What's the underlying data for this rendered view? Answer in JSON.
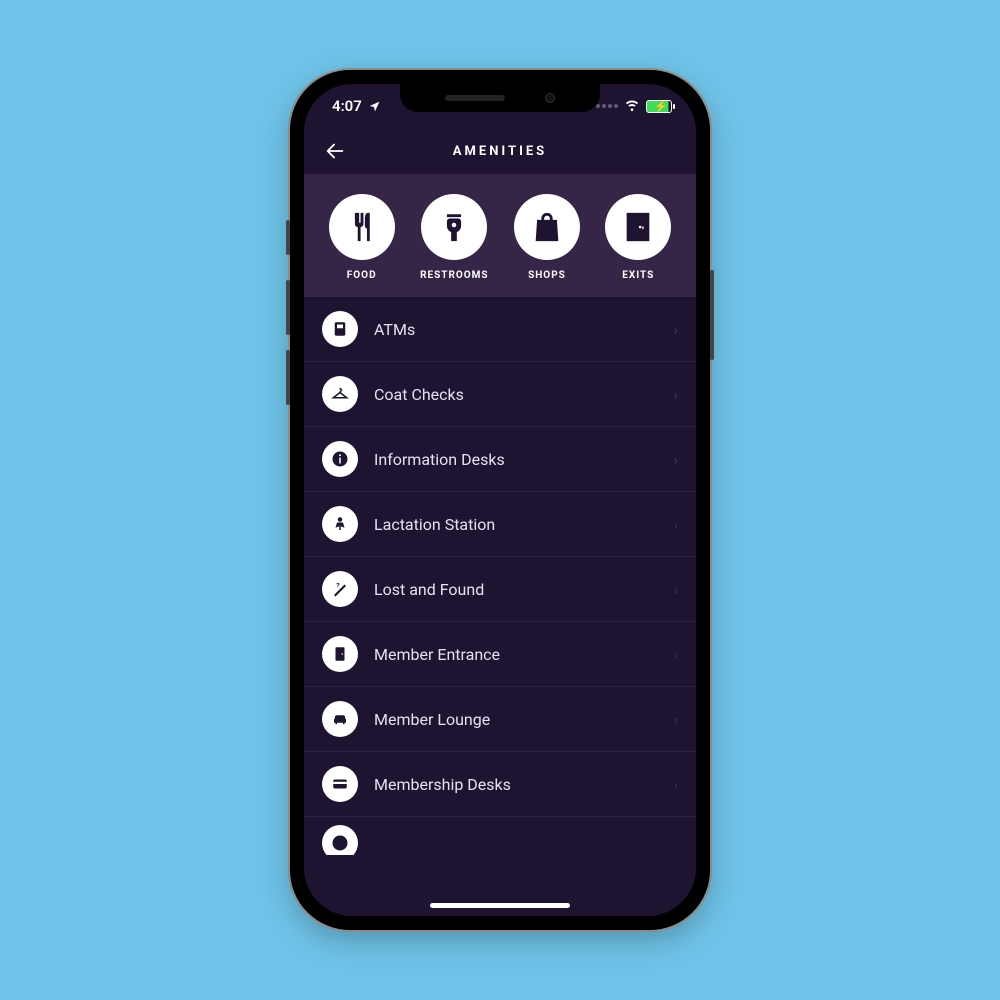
{
  "status": {
    "time": "4:07",
    "location_arrow": true,
    "wifi": true,
    "battery_charging": true
  },
  "header": {
    "title": "AMENITIES"
  },
  "categories": [
    {
      "icon": "food",
      "label": "FOOD"
    },
    {
      "icon": "restroom",
      "label": "RESTROOMS"
    },
    {
      "icon": "shop",
      "label": "SHOPS"
    },
    {
      "icon": "exit",
      "label": "EXITS"
    }
  ],
  "list": [
    {
      "icon": "atm",
      "label": "ATMs"
    },
    {
      "icon": "hanger",
      "label": "Coat Checks"
    },
    {
      "icon": "info",
      "label": "Information Desks"
    },
    {
      "icon": "lactation",
      "label": "Lactation Station"
    },
    {
      "icon": "lostfound",
      "label": "Lost and Found"
    },
    {
      "icon": "door",
      "label": "Member Entrance"
    },
    {
      "icon": "lounge",
      "label": "Member Lounge"
    },
    {
      "icon": "card",
      "label": "Membership Desks"
    }
  ]
}
